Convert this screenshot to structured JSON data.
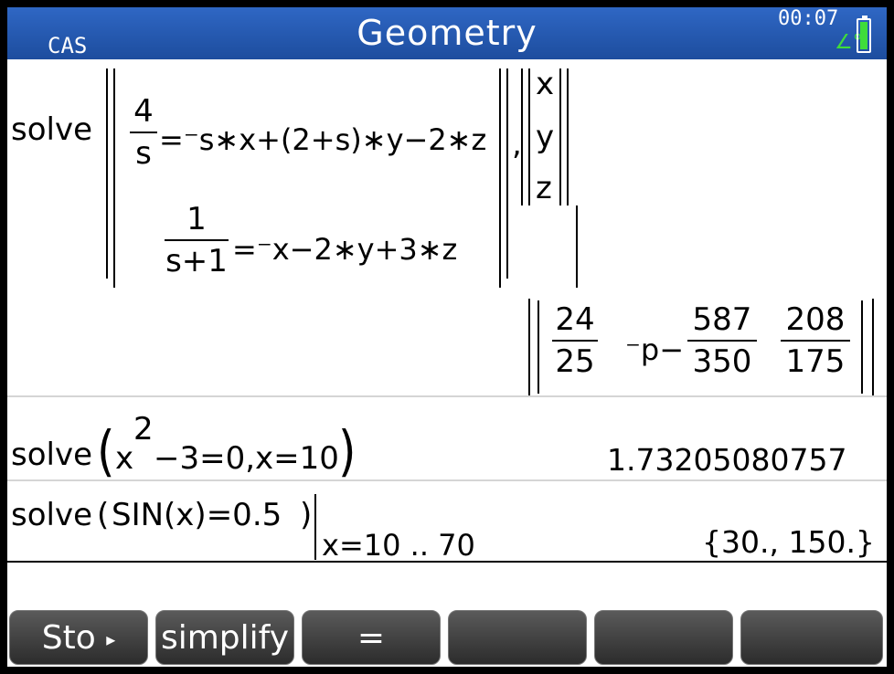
{
  "titlebar": {
    "title": "Geometry",
    "mode": "CAS",
    "time": "00:07",
    "angle_indicator": "∠°",
    "battery_icon": "battery-icon"
  },
  "history": [
    {
      "id": "solve-system",
      "input": {
        "command": "solve",
        "eq1": {
          "lhs_num": "4",
          "lhs_den": "s",
          "rhs": "=⁻s∗x+(2+s)∗y−2∗z"
        },
        "eq2": {
          "lhs_num": "1",
          "lhs_den": "s+1",
          "rhs": "=⁻x−2∗y+3∗z"
        },
        "vars": [
          "x",
          "y",
          "z"
        ]
      },
      "output": {
        "a_num": "24",
        "a_den": "25",
        "b_prefix": "⁻p−",
        "b_num": "587",
        "b_den": "350",
        "c_num": "208",
        "c_den": "175"
      }
    },
    {
      "id": "solve-quadratic",
      "input": {
        "command": "solve",
        "base": "x",
        "exponent": "2",
        "rest": "−3=0,x=10"
      },
      "output": "1.73205080757"
    },
    {
      "id": "solve-sin",
      "input": {
        "command": "solve",
        "expr": "SIN(x)=0.5",
        "condition": "x=10 .. 70"
      },
      "output": "{30., 150.}"
    }
  ],
  "softkeys": [
    {
      "label": "Sto",
      "icon": "▸"
    },
    {
      "label": "simplify"
    },
    {
      "label": "="
    },
    {
      "label": ""
    },
    {
      "label": ""
    },
    {
      "label": ""
    }
  ],
  "colors": {
    "titlebar": "#2f67c4",
    "angle": "#3fdc3a",
    "softkey": "#3c3c3c"
  }
}
